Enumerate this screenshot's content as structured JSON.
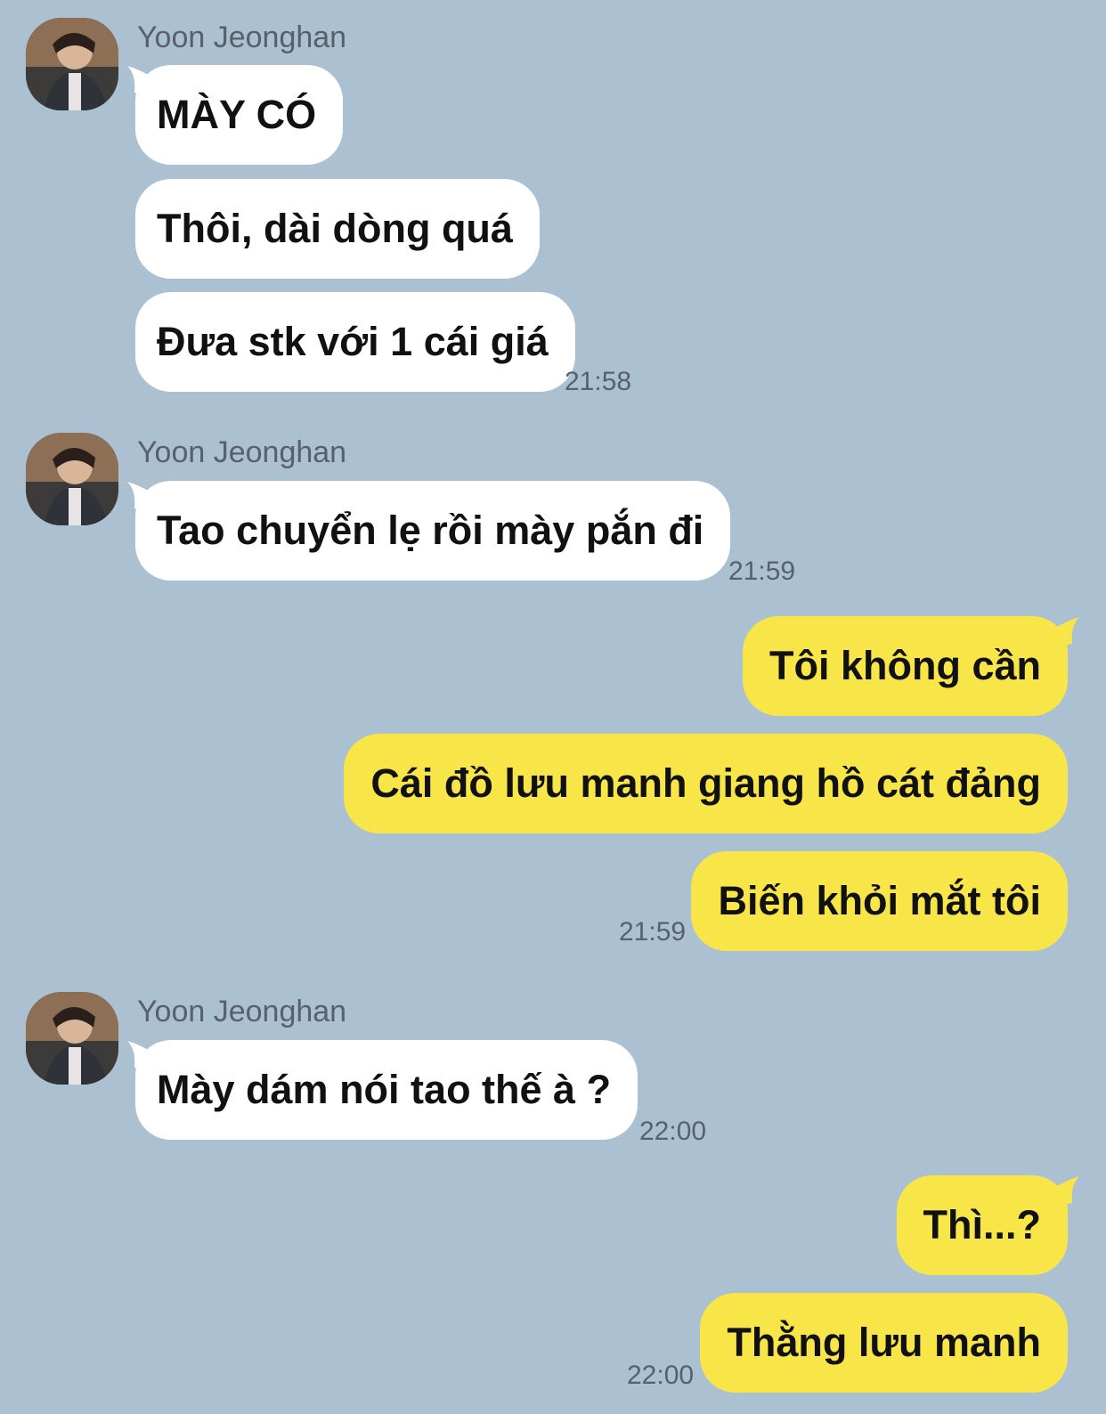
{
  "colors": {
    "background": "#abc1d1",
    "incoming_bubble": "#ffffff",
    "outgoing_bubble": "#f8e649"
  },
  "groups": [
    {
      "sender": "Yoon Jeonghan",
      "messages": [
        "MÀY CÓ",
        "Thôi, dài dòng quá",
        "Đưa stk với 1 cái giá"
      ],
      "time": "21:58"
    },
    {
      "sender": "Yoon Jeonghan",
      "messages": [
        "Tao chuyển lẹ rồi mày pắn đi"
      ],
      "time": "21:59"
    },
    {
      "sender": "me",
      "messages": [
        "Tôi không cần",
        "Cái đồ lưu manh giang hồ cát đảng",
        "Biến khỏi mắt tôi"
      ],
      "time": "21:59"
    },
    {
      "sender": "Yoon Jeonghan",
      "messages": [
        "Mày dám nói tao thế à ?"
      ],
      "time": "22:00"
    },
    {
      "sender": "me",
      "messages": [
        "Thì...?",
        "Thằng lưu manh"
      ],
      "time": "22:00"
    }
  ]
}
